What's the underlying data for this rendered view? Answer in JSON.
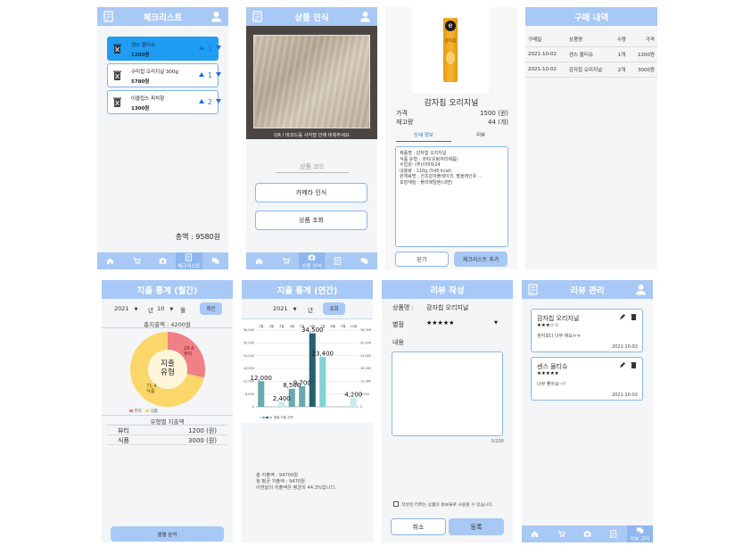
{
  "s1": {
    "title": "체크리스트",
    "items": [
      {
        "name": "센스 물티슈",
        "price": "1200원",
        "qty": "1"
      },
      {
        "name": "수미칩 오리지널 300g",
        "price": "5780원",
        "qty": "1"
      },
      {
        "name": "이클립스 피치향",
        "price": "1300원",
        "qty": "2"
      }
    ],
    "total": "총액 : 9580원",
    "nav_label": "체크리스트"
  },
  "s2": {
    "title": "상품 인식",
    "camera_hint": "QR / 바코드를 사각형 안에 비춰주세요",
    "code_placeholder": "상품 코드",
    "camera_btn": "카메라 인식",
    "lookup_btn": "상품 조회",
    "nav_label": "상품 인식"
  },
  "s3": {
    "product_name": "감자칩 오리지널",
    "price_label": "가격",
    "price_value": "1500 (원)",
    "stock_label": "재고량",
    "stock_value": "44 (개)",
    "tab_detail": "상세 정보",
    "tab_review": "리뷰",
    "detail_lines": [
      "제품명 : 감자칩 오리지널",
      "식품 유형 : 과자(유탕처리제품)",
      "수입원: (주)이마트24",
      "내용량 : 110g (545 kcal)",
      "원재료명 : 건조감자플레이크, 팜올레인유 ...",
      "포장재질 : 폴리에틸렌(내면)"
    ],
    "close_btn": "닫기",
    "add_btn": "체크리스트 추가",
    "package_letter": "e",
    "package_text": "감자칩"
  },
  "s4": {
    "title": "구매 내역",
    "headers": [
      "구매일",
      "상품명",
      "수량",
      "가격"
    ],
    "rows": [
      [
        "2021-10-02",
        "센스 물티슈",
        "1개",
        "1200원"
      ],
      [
        "2021-10-02",
        "감자칩 오리지널",
        "2개",
        "3000원"
      ]
    ]
  },
  "s5": {
    "title": "지출 통계 (월간)",
    "year": "2021",
    "year_unit": "년",
    "month": "10",
    "month_unit": "월",
    "confirm_btn": "확인",
    "total_label": "총지출액 : 4200원",
    "center_label_1": "지출",
    "center_label_2": "유형",
    "slices": [
      {
        "label": "뷰티",
        "value": 28.6,
        "color": "#f07f86",
        "text": "28.6\n뷰티"
      },
      {
        "label": "식품",
        "value": 71.4,
        "color": "#fbd66a",
        "text": "71.4\n식품"
      }
    ],
    "legend": [
      "뷰티",
      "식품"
    ],
    "type_header": "유형별 지출액",
    "type_rows": [
      {
        "name": "뷰티",
        "amount": "1200 (원)"
      },
      {
        "name": "식품",
        "amount": "3000 (원)"
      }
    ],
    "bottom_btn": "월별 분석"
  },
  "s6": {
    "title": "지출 통계 (연간)",
    "year": "2021",
    "year_unit": "년",
    "lookup_btn": "조회",
    "summary_lines": [
      "총 지출액 : 94700원",
      "월 평균 지출액 : 9470원",
      "이번달의 지출액은 평균의 44.3%입니다."
    ],
    "legend_label": "월별 지출 금액"
  },
  "chart_data": {
    "type": "bar",
    "categories": [
      "1월",
      "2월",
      "3월",
      "4월",
      "5월",
      "6월",
      "7월",
      "8월",
      "9월",
      "10월"
    ],
    "values": [
      12000,
      0,
      2400,
      8500,
      9700,
      34500,
      23400,
      0,
      0,
      4200
    ],
    "ylim": [
      0,
      36000
    ],
    "yticks": [
      "0",
      "6,000",
      "12,000",
      "18,000",
      "24,000",
      "30,000",
      "36,000"
    ],
    "title": "",
    "colors": {
      "default": "#c8ecee",
      "mid": "#6aa9b0",
      "dark": "#24616f",
      "teal": "#7fd4d4"
    }
  },
  "s7": {
    "title": "리뷰 작성",
    "product_label": "상품명 :",
    "product_value": "감자칩 오리지널",
    "rating_label": "별점",
    "rating_stars": "★★★★★",
    "content_label": "내용",
    "counter": "0/200",
    "agree_text": "작성된 리뷰는 상품의 홍보물로 사용될 수 있습니다.",
    "cancel_btn": "취소",
    "submit_btn": "등록"
  },
  "s8": {
    "title": "리뷰 관리",
    "reviews": [
      {
        "product": "감자칩 오리지널",
        "stars": "★★★☆☆",
        "text": "생각보다 너무 짜요ㅠㅠ",
        "date": "2021-10-02"
      },
      {
        "product": "센스 물티슈",
        "stars": "★★★★★",
        "text": "너무 좋아요~!!",
        "date": "2021-10-02"
      }
    ],
    "nav_label": "리뷰 관리"
  }
}
